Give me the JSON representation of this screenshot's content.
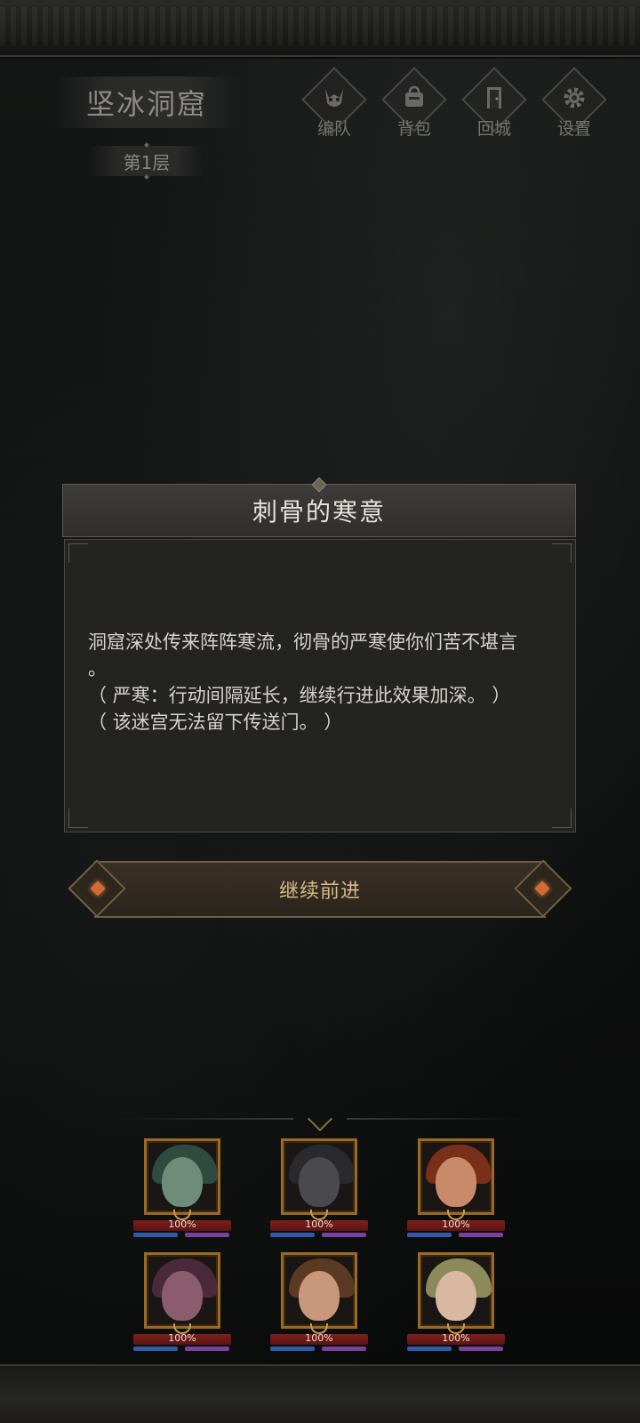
{
  "map": {
    "name": "坚冰洞窟",
    "floor": "第1层"
  },
  "menu": [
    {
      "name": "formation",
      "label": "编队",
      "icon": "mask-icon"
    },
    {
      "name": "backpack",
      "label": "背包",
      "icon": "bag-icon"
    },
    {
      "name": "return-town",
      "label": "回城",
      "icon": "door-icon"
    },
    {
      "name": "settings",
      "label": "设置",
      "icon": "gear-icon"
    }
  ],
  "dialog": {
    "title": "刺骨的寒意",
    "line1": "洞窟深处传来阵阵寒流，彻骨的严寒使你们苦不堪言",
    "line1b": "。",
    "line2": "（ 严寒：行动间隔延长，继续行进此效果加深。 ）",
    "line3": "（ 该迷宫无法留下传送门。 ）"
  },
  "continue_label": "继续前进",
  "party": [
    {
      "hp": "100%",
      "hair": "#2f4a3e",
      "skin": "#6f8c7a"
    },
    {
      "hp": "100%",
      "hair": "#2a2a2c",
      "skin": "#4a4a4e"
    },
    {
      "hp": "100%",
      "hair": "#7a3018",
      "skin": "#c98a6a"
    },
    {
      "hp": "100%",
      "hair": "#4a2a3a",
      "skin": "#8a5c6e"
    },
    {
      "hp": "100%",
      "hair": "#5a3a22",
      "skin": "#c9987a"
    },
    {
      "hp": "100%",
      "hair": "#8c8a5a",
      "skin": "#d8b8a0"
    }
  ]
}
